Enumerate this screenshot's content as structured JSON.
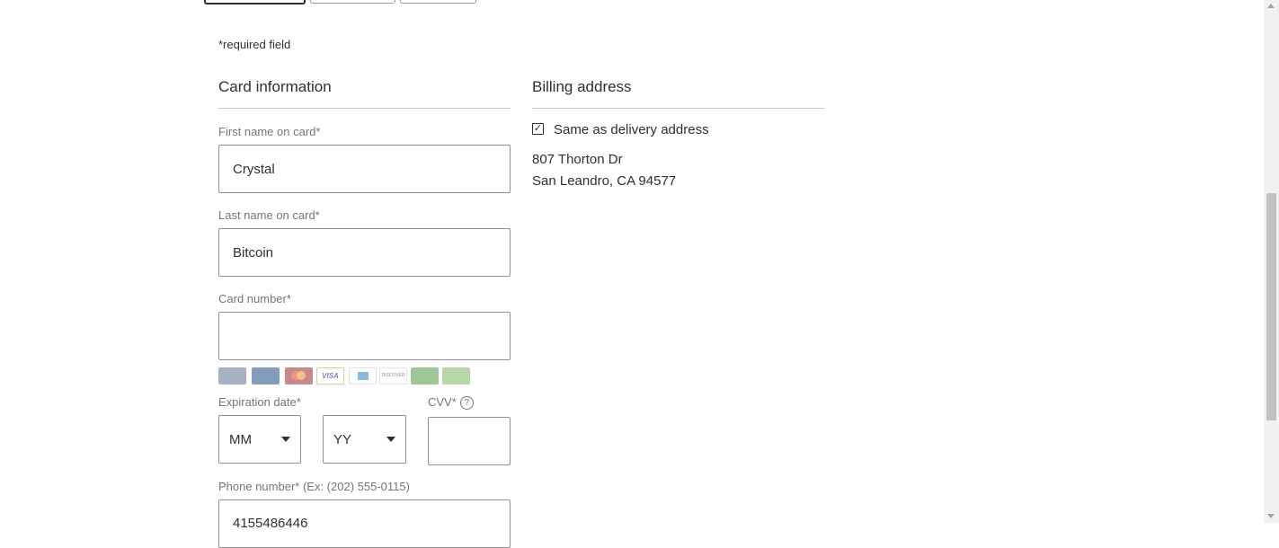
{
  "required_note": "*required field",
  "card_section": {
    "title": "Card information",
    "first_name": {
      "label": "First name on card*",
      "value": "Crystal"
    },
    "last_name": {
      "label": "Last name on card*",
      "value": "Bitcoin"
    },
    "card_number": {
      "label": "Card number*",
      "value": ""
    },
    "card_logos": [
      "walmart-credit-card",
      "walmart-mastercard",
      "mastercard",
      "visa",
      "amex",
      "discover",
      "green-card",
      "green-card-2"
    ],
    "expiration": {
      "label": "Expiration date*",
      "month": "MM",
      "year": "YY"
    },
    "cvv": {
      "label": "CVV*",
      "help_icon": "question-circle-icon",
      "value": ""
    },
    "phone": {
      "label": "Phone number* (Ex: (202) 555-0115)",
      "value": "4155486446"
    }
  },
  "billing_section": {
    "title": "Billing address",
    "same_as_delivery_label": "Same as delivery address",
    "same_as_delivery_checked": true,
    "address_line1": "807 Thorton Dr",
    "address_line2": "San Leandro, CA 94577"
  }
}
